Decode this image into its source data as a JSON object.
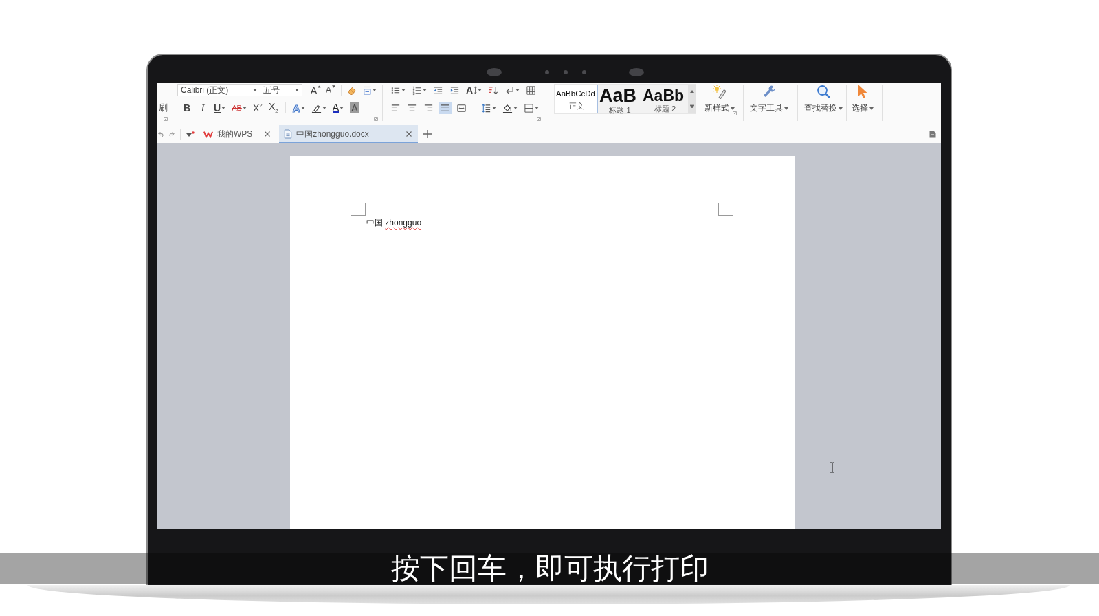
{
  "ribbon": {
    "format_painter_label": "刷",
    "font_name": "Calibri (正文)",
    "font_size": "五号",
    "font_row1": [
      {
        "kind": "grow",
        "label": "A",
        "dropdown": false
      },
      {
        "kind": "shrink",
        "label": "A",
        "dropdown": false
      },
      {
        "kind": "clear",
        "dropdown": false
      },
      {
        "kind": "phonetic",
        "dropdown": true
      }
    ],
    "font_row2": [
      {
        "kind": "bold",
        "label": "B",
        "dropdown": false
      },
      {
        "kind": "italic",
        "label": "I",
        "dropdown": false
      },
      {
        "kind": "underline",
        "label": "U",
        "dropdown": true
      },
      {
        "kind": "strike",
        "label": "AB",
        "dropdown": true
      },
      {
        "kind": "superscript",
        "label": "X$^{2}$",
        "dropdown": false
      },
      {
        "kind": "subscript",
        "label": "X$_{2}$",
        "dropdown": false
      },
      {
        "kind": "effect",
        "label": "A",
        "dropdown": true
      },
      {
        "kind": "highlight",
        "dropdown": true
      },
      {
        "kind": "font-color",
        "label": "A",
        "dropdown": true
      },
      {
        "kind": "shading",
        "label": "A",
        "dropdown": false
      }
    ],
    "para_row1": [
      {
        "kind": "bullets",
        "dropdown": true
      },
      {
        "kind": "numbering",
        "dropdown": true
      },
      {
        "kind": "outdent",
        "dropdown": false
      },
      {
        "kind": "indent",
        "dropdown": false
      },
      {
        "kind": "direction",
        "label": "A",
        "dropdown": true
      },
      {
        "kind": "sort",
        "dropdown": false
      },
      {
        "kind": "marks",
        "dropdown": true
      },
      {
        "kind": "table",
        "dropdown": false
      }
    ],
    "alignment": [
      {
        "kind": "left",
        "selected": false
      },
      {
        "kind": "center",
        "selected": false
      },
      {
        "kind": "right",
        "selected": false
      },
      {
        "kind": "justify",
        "selected": true
      },
      {
        "kind": "distributed",
        "selected": false
      }
    ],
    "para_row2": [
      {
        "kind": "line-spacing",
        "dropdown": true
      },
      {
        "kind": "fill",
        "dropdown": true
      },
      {
        "kind": "borders",
        "dropdown": true
      }
    ],
    "styles": [
      {
        "kind": "body",
        "preview": "AaBbCcDd",
        "name": "正文",
        "selected": true
      },
      {
        "kind": "heading-1",
        "preview": "AaB",
        "name": "标题 1",
        "selected": false
      },
      {
        "kind": "heading-2",
        "preview": "AaBb",
        "name": "标题 2",
        "selected": false
      }
    ],
    "tools": [
      {
        "kind": "new-style",
        "label": "新样式",
        "dropdown": true
      },
      {
        "kind": "text-tools",
        "label": "文字工具",
        "dropdown": true
      },
      {
        "kind": "find-replace",
        "label": "查找替换",
        "dropdown": true
      },
      {
        "kind": "select",
        "label": "选择",
        "dropdown": true
      }
    ]
  },
  "tab_bar": {
    "tabs": [
      {
        "kind": "home",
        "label": "我的WPS",
        "selected": false
      },
      {
        "kind": "document",
        "label": "中国zhongguo.docx",
        "selected": true
      }
    ]
  },
  "document": {
    "text": "中国",
    "word": "zhongguo",
    "misspelled": true
  },
  "subtitle": "按下回车，即可执行打印"
}
